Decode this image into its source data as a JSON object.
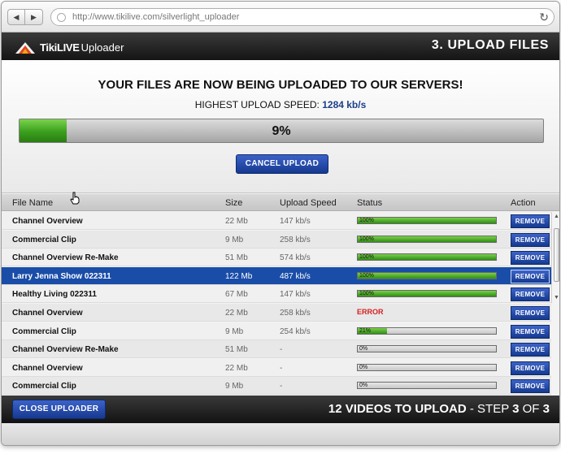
{
  "browser": {
    "url": "http://www.tikilive.com/silverlight_uploader"
  },
  "app": {
    "brand": "TikiLIVE",
    "product": "Uploader",
    "step_title": "3. UPLOAD FILES"
  },
  "upload": {
    "headline": "YOUR FILES ARE NOW BEING UPLOADED TO OUR SERVERS!",
    "speed_label": "HIGHEST UPLOAD SPEED:",
    "speed_value": "1284 kb/s",
    "progress_label": "9%",
    "progress_fraction": 0.09,
    "cancel_label": "CANCEL UPLOAD"
  },
  "table": {
    "headers": {
      "name": "File Name",
      "size": "Size",
      "speed": "Upload Speed",
      "status": "Status",
      "action": "Action"
    },
    "rows": [
      {
        "name": "Channel Overview",
        "size": "22 Mb",
        "speed": "147 kb/s",
        "status": "100%",
        "progress": 1.0,
        "error": false,
        "selected": false,
        "action": "REMOVE"
      },
      {
        "name": "Commercial Clip",
        "size": "9 Mb",
        "speed": "258 kb/s",
        "status": "100%",
        "progress": 1.0,
        "error": false,
        "selected": false,
        "action": "REMOVE"
      },
      {
        "name": "Channel Overview Re-Make",
        "size": "51 Mb",
        "speed": "574 kb/s",
        "status": "100%",
        "progress": 1.0,
        "error": false,
        "selected": false,
        "action": "REMOVE"
      },
      {
        "name": "Larry Jenna Show 022311",
        "size": "122 Mb",
        "speed": "487 kb/s",
        "status": "100%",
        "progress": 1.0,
        "error": false,
        "selected": true,
        "action": "REMOVE"
      },
      {
        "name": "Healthy Living 022311",
        "size": "67 Mb",
        "speed": "147 kb/s",
        "status": "100%",
        "progress": 1.0,
        "error": false,
        "selected": false,
        "action": "REMOVE"
      },
      {
        "name": "Channel Overview",
        "size": "22 Mb",
        "speed": "258 kb/s",
        "status": "ERROR",
        "progress": 0,
        "error": true,
        "selected": false,
        "action": "REMOVE"
      },
      {
        "name": "Commercial Clip",
        "size": "9 Mb",
        "speed": "254 kb/s",
        "status": "21%",
        "progress": 0.21,
        "error": false,
        "selected": false,
        "action": "REMOVE"
      },
      {
        "name": "Channel Overview Re-Make",
        "size": "51 Mb",
        "speed": "-",
        "status": "0%",
        "progress": 0,
        "error": false,
        "selected": false,
        "action": "REMOVE"
      },
      {
        "name": "Channel Overview",
        "size": "22 Mb",
        "speed": "-",
        "status": "0%",
        "progress": 0,
        "error": false,
        "selected": false,
        "action": "REMOVE"
      },
      {
        "name": "Commercial Clip",
        "size": "9 Mb",
        "speed": "-",
        "status": "0%",
        "progress": 0,
        "error": false,
        "selected": false,
        "action": "REMOVE"
      }
    ]
  },
  "footer": {
    "close_label": "CLOSE UPLOADER",
    "videos_count": "12",
    "videos_text": "VIDEOS TO UPLOAD",
    "step_text": "- STEP",
    "step_current": "3",
    "step_of": "OF",
    "step_total": "3"
  },
  "colors": {
    "accent_blue": "#1b3f8a",
    "button_blue": "#16398f",
    "progress_green": "#3a9f1d",
    "error_red": "#d42020",
    "selected_row": "#1a4da8"
  }
}
